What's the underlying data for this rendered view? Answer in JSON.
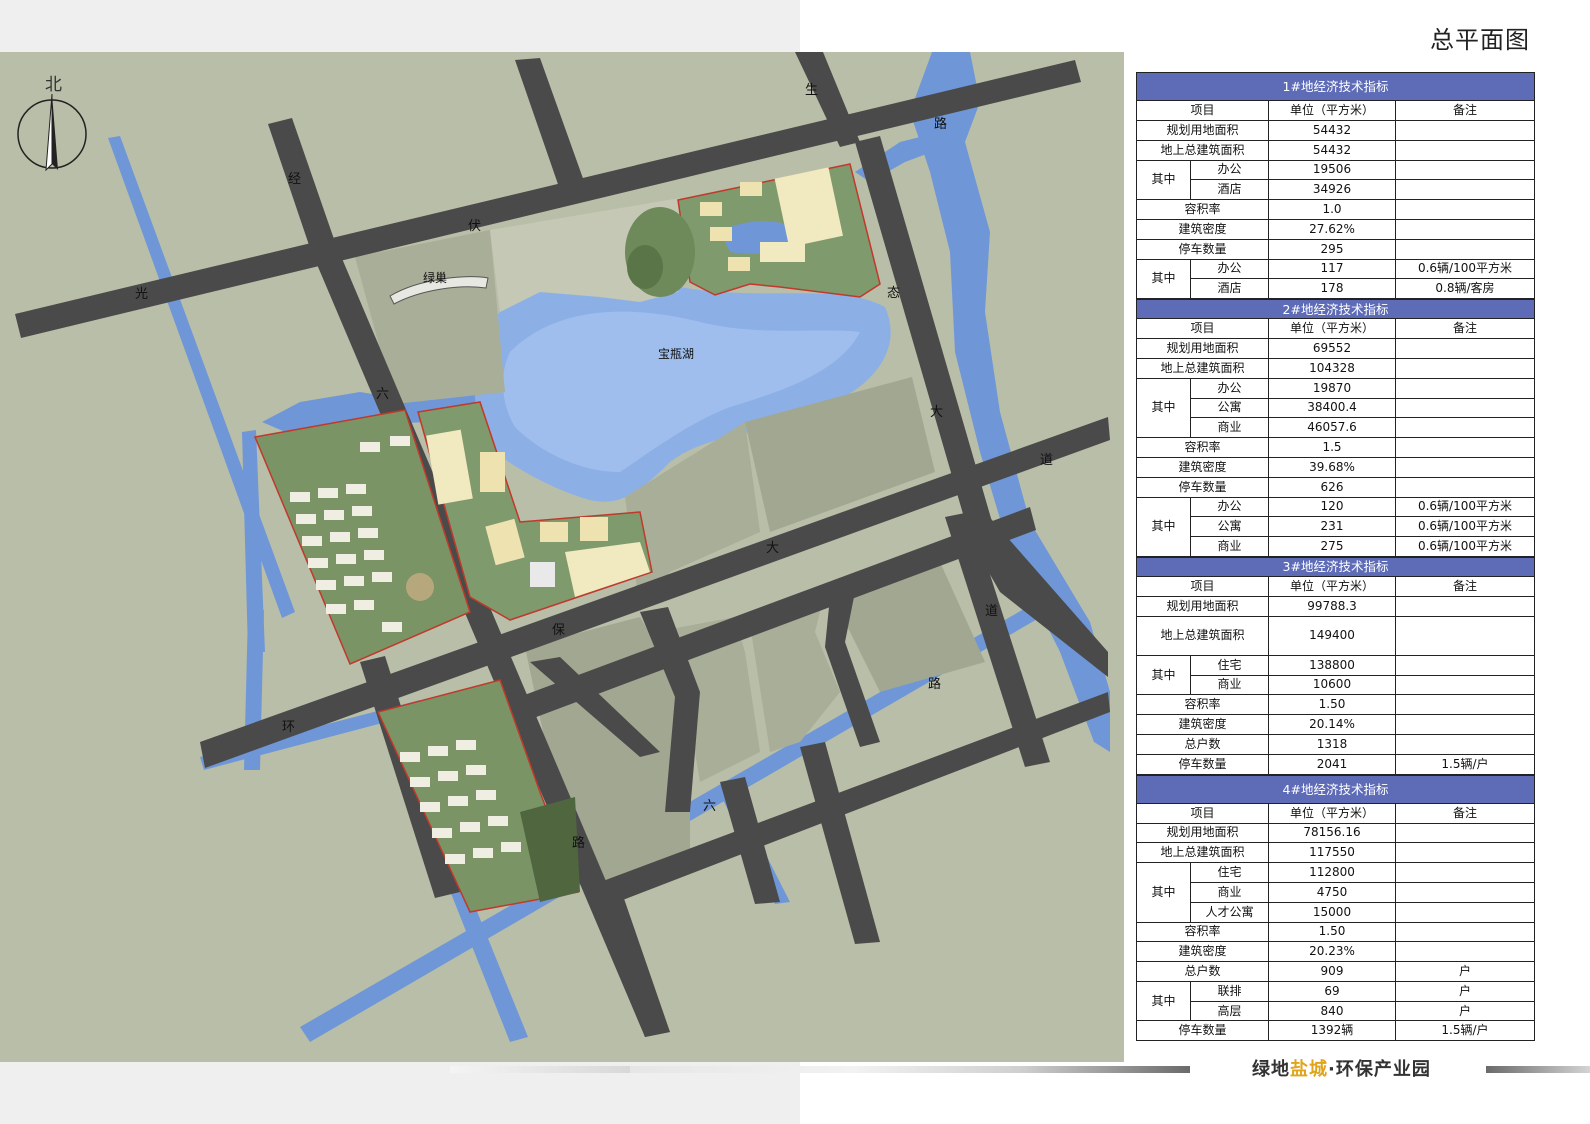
{
  "page_title": "总平面图",
  "compass": {
    "label": "北"
  },
  "map": {
    "road_labels": {
      "jingfu_1": "经",
      "jingfu_2": "伏",
      "guang": "光",
      "sheng": "生",
      "lu_ne": "路",
      "tai": "态",
      "da_e1": "大",
      "dao_e1": "道",
      "da_mid": "大",
      "dao_e2": "道",
      "lu_e2": "路",
      "liu_n": "六",
      "bao": "保",
      "huan": "环",
      "liu_s": "六",
      "lu_s": "路"
    },
    "place_labels": {
      "lvchao": "绿巢",
      "lake": "宝瓶湖"
    }
  },
  "colors": {
    "header": "#5e6cb8",
    "road": "#4a4a4a",
    "water": "#6f97d8",
    "land": "#b9bea8",
    "accent": "#e0a51c"
  },
  "tables": {
    "t1": {
      "title": "1#地经济技术指标",
      "head": [
        "项目",
        "单位（平方米）",
        "备注"
      ],
      "rows": [
        [
          "规划用地面积",
          "54432",
          ""
        ],
        [
          "地上总建筑面积",
          "54432",
          ""
        ],
        [
          "其中",
          "办公",
          "19506",
          ""
        ],
        [
          "",
          "酒店",
          "34926",
          ""
        ],
        [
          "容积率",
          "1.0",
          ""
        ],
        [
          "建筑密度",
          "27.62%",
          ""
        ],
        [
          "停车数量",
          "295",
          ""
        ],
        [
          "其中",
          "办公",
          "117",
          "0.6辆/100平方米"
        ],
        [
          "",
          "酒店",
          "178",
          "0.8辆/客房"
        ]
      ]
    },
    "t2": {
      "title": "2#地经济技术指标",
      "head": [
        "项目",
        "单位（平方米）",
        "备注"
      ],
      "rows": [
        [
          "规划用地面积",
          "69552",
          ""
        ],
        [
          "地上总建筑面积",
          "104328",
          ""
        ],
        [
          "其中",
          "办公",
          "19870",
          ""
        ],
        [
          "",
          "公寓",
          "38400.4",
          ""
        ],
        [
          "",
          "商业",
          "46057.6",
          ""
        ],
        [
          "容积率",
          "1.5",
          ""
        ],
        [
          "建筑密度",
          "39.68%",
          ""
        ],
        [
          "停车数量",
          "626",
          ""
        ],
        [
          "其中",
          "办公",
          "120",
          "0.6辆/100平方米"
        ],
        [
          "",
          "公寓",
          "231",
          "0.6辆/100平方米"
        ],
        [
          "",
          "商业",
          "275",
          "0.6辆/100平方米"
        ]
      ]
    },
    "t3": {
      "title": "3#地经济技术指标",
      "head": [
        "项目",
        "单位（平方米）",
        "备注"
      ],
      "rows": [
        [
          "规划用地面积",
          "99788.3",
          ""
        ],
        [
          "地上总建筑面积",
          "149400",
          ""
        ],
        [
          "其中",
          "住宅",
          "138800",
          ""
        ],
        [
          "",
          "商业",
          "10600",
          ""
        ],
        [
          "容积率",
          "1.50",
          ""
        ],
        [
          "建筑密度",
          "20.14%",
          ""
        ],
        [
          "总户数",
          "1318",
          ""
        ],
        [
          "停车数量",
          "2041",
          "1.5辆/户"
        ]
      ]
    },
    "t4": {
      "title": "4#地经济技术指标",
      "head": [
        "项目",
        "单位（平方米）",
        "备注"
      ],
      "rows": [
        [
          "规划用地面积",
          "78156.16",
          ""
        ],
        [
          "地上总建筑面积",
          "117550",
          ""
        ],
        [
          "其中",
          "住宅",
          "112800",
          ""
        ],
        [
          "",
          "商业",
          "4750",
          ""
        ],
        [
          "",
          "人才公寓",
          "15000",
          ""
        ],
        [
          "容积率",
          "1.50",
          ""
        ],
        [
          "建筑密度",
          "20.23%",
          ""
        ],
        [
          "总户数",
          "909",
          "户"
        ],
        [
          "其中",
          "联排",
          "69",
          "户"
        ],
        [
          "",
          "高层",
          "840",
          "户"
        ],
        [
          "停车数量",
          "1392辆",
          "1.5辆/户"
        ]
      ]
    }
  },
  "footer": {
    "brand_a": "绿地",
    "brand_b": "盐城",
    "brand_c": "·环保产业园"
  }
}
